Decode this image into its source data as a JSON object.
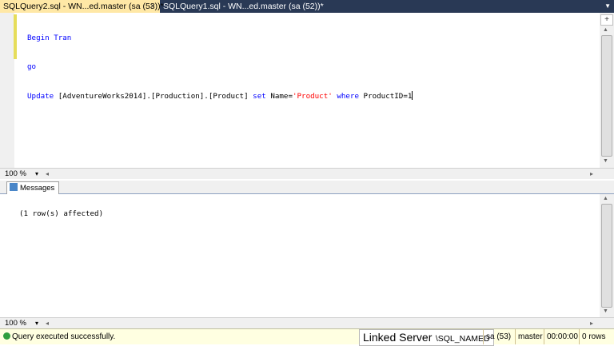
{
  "tabs": [
    {
      "label": "SQLQuery2.sql - WN...ed.master (sa (53))*",
      "close": "×",
      "active": true
    },
    {
      "label": "SQLQuery1.sql - WN...ed.master (sa (52))*",
      "active": false
    }
  ],
  "tab_menu_icon": "chevron-down-icon",
  "editor": {
    "line1": {
      "kw": "Begin Tran"
    },
    "line2": {
      "kw": "go"
    },
    "line3": {
      "kw1": "Update",
      "obj": "[AdventureWorks2014].[Production].[Product]",
      "kw2": "set",
      "col": "Name=",
      "str": "'Product'",
      "kw3": "where",
      "cond": "ProductID=1"
    }
  },
  "zoom_top": {
    "label": "100 %",
    "dropdown": "▾"
  },
  "zoom_bottom": {
    "label": "100 %",
    "dropdown": "▾"
  },
  "results_tabs": [
    {
      "label": "Messages",
      "icon": "messages-icon"
    }
  ],
  "messages": {
    "text": "(1 row(s) affected)"
  },
  "statusbar": {
    "status_text": "Query executed successfully.",
    "status_icon": "success-check-icon",
    "server_prefix": "Linked Server",
    "server_suffix": "\\SQL_NAMED",
    "session": "sa (53)",
    "database": "master",
    "elapsed": "00:00:00",
    "rows": "0 rows"
  },
  "colors": {
    "keyword": "#0000ff",
    "string": "#ff0000",
    "tabbar": "#293955",
    "active_tab": "#ffe8a6",
    "status_bg": "#ffffe1"
  }
}
